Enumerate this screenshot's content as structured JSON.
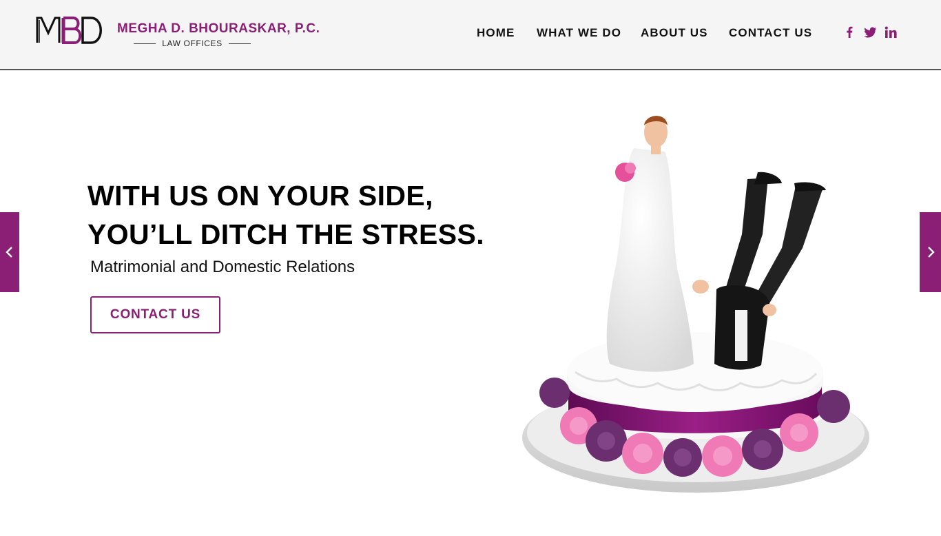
{
  "brand": {
    "monogram": "MBD",
    "name": "MEGHA D. BHOURASKAR, P.C.",
    "subtitle": "LAW OFFICES",
    "accent": "#8b1f76"
  },
  "nav": {
    "items": [
      "HOME",
      "WHAT WE DO",
      "ABOUT US",
      "CONTACT US"
    ]
  },
  "social": {
    "icons": [
      "facebook-icon",
      "twitter-icon",
      "linkedin-icon"
    ]
  },
  "hero": {
    "headline_line1": "WITH US ON YOUR SIDE,",
    "headline_line2": "YOU’LL DITCH THE STRESS.",
    "subheadline": "Matrimonial and Domestic Relations",
    "cta_label": "CONTACT US",
    "image_subject": "wedding cake topper"
  },
  "slider": {
    "prev_icon": "chevron-left-icon",
    "next_icon": "chevron-right-icon"
  }
}
